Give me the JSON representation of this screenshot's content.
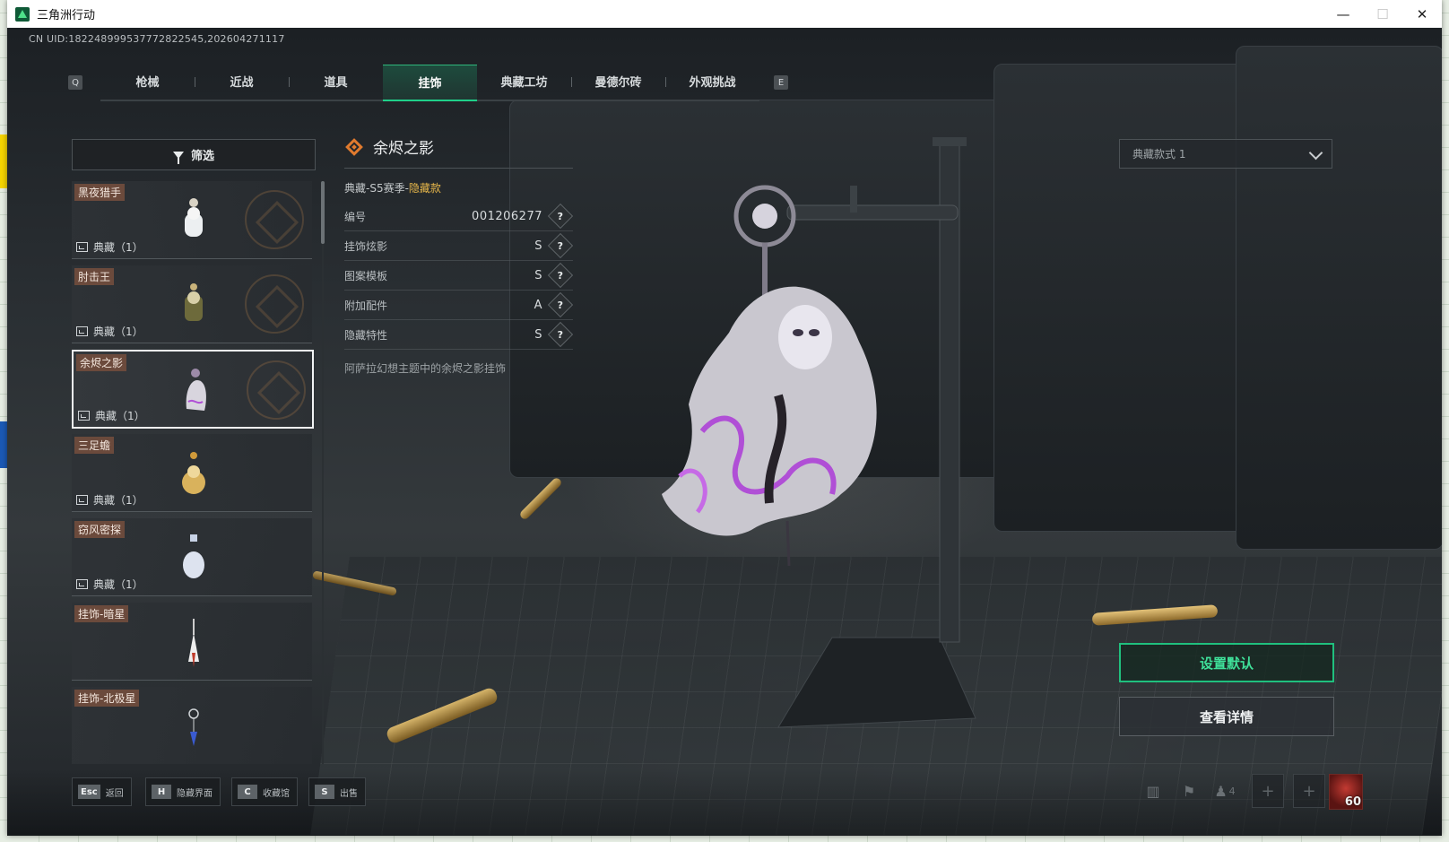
{
  "window": {
    "title": "三角洲行动"
  },
  "uid": "CN UID:18224899953777282254​5,202604271117",
  "tabs": {
    "left_key": "Q",
    "right_key": "E",
    "items": [
      "枪械",
      "近战",
      "道具",
      "挂饰",
      "典藏工坊",
      "曼德尔砖",
      "外观挑战"
    ],
    "active_index": 3
  },
  "filter": {
    "label": "筛选"
  },
  "items": [
    {
      "name": "黑夜猎手",
      "tag": "典藏（1）",
      "selected": false
    },
    {
      "name": "肘击王",
      "tag": "典藏（1）",
      "selected": false
    },
    {
      "name": "余烬之影",
      "tag": "典藏（1）",
      "selected": true
    },
    {
      "name": "三足蟾",
      "tag": "典藏（1）",
      "selected": false
    },
    {
      "name": "窃风密探",
      "tag": "典藏（1）",
      "selected": false
    },
    {
      "name": "挂饰-暗星",
      "tag": "",
      "selected": false
    },
    {
      "name": "挂饰-北极星",
      "tag": "",
      "selected": false
    }
  ],
  "detail": {
    "title": "余烬之影",
    "season_prefix": "典藏-S5赛季-",
    "season_accent": "隐藏款",
    "attributes": [
      {
        "label": "编号",
        "value": "001206277"
      },
      {
        "label": "挂饰炫影",
        "value": "S"
      },
      {
        "label": "图案模板",
        "value": "S"
      },
      {
        "label": "附加配件",
        "value": "A"
      },
      {
        "label": "隐藏特性",
        "value": "S"
      }
    ],
    "help_glyph": "?",
    "description": "阿萨拉幻想主题中的余烬之影挂饰"
  },
  "variant_select": {
    "value": "典藏款式 1"
  },
  "actions": {
    "set_default": "设置默认",
    "view_details": "查看详情"
  },
  "hotkeys": [
    {
      "key": "Esc",
      "label": "返回"
    },
    {
      "key": "H",
      "label": "隐藏界面"
    },
    {
      "key": "C",
      "label": "收藏馆"
    },
    {
      "key": "S",
      "label": "出售"
    }
  ],
  "status": {
    "party_count": "4",
    "player_level": "60"
  },
  "colors": {
    "accent_green": "#1fd08a",
    "rarity_orange": "#e07a2e",
    "hidden_gold": "#e6b64a",
    "name_tag_bg": "#6b4a3c"
  }
}
